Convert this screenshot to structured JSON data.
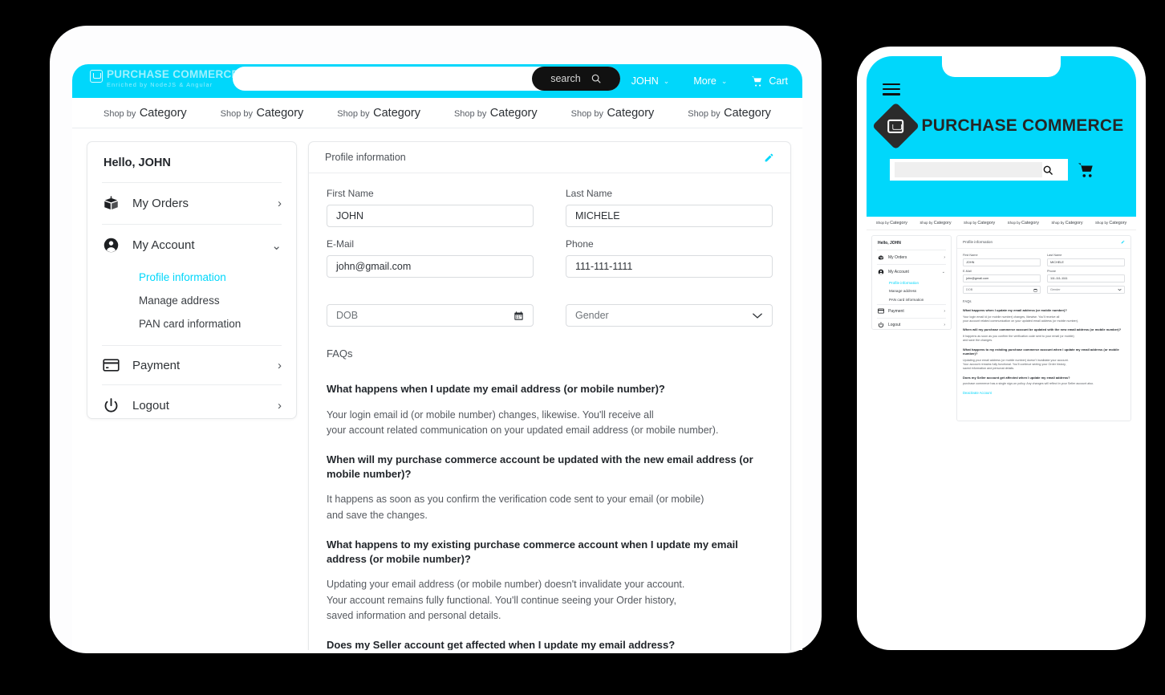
{
  "brand": {
    "name": "PURCHASE COMMERCE",
    "tagline": "Enriched by NodeJS & Angular",
    "accent": "#00d7fb",
    "dark": "#111111"
  },
  "desktop": {
    "header": {
      "search_placeholder": "",
      "search_value": "",
      "search_button": "search",
      "search_icon": "magnifier-icon",
      "user_menu": "JOHN",
      "more_menu": "More",
      "cart_label": "Cart",
      "cart_icon": "cart-icon",
      "chevron": "⌄"
    },
    "categories": [
      {
        "small": "Shop by",
        "big": "Category"
      },
      {
        "small": "Shop by",
        "big": "Category"
      },
      {
        "small": "Shop by",
        "big": "Category"
      },
      {
        "small": "Shop by",
        "big": "Category"
      },
      {
        "small": "Shop by",
        "big": "Category"
      },
      {
        "small": "Shop by",
        "big": "Category"
      }
    ],
    "sidebar": {
      "greeting": "Hello, JOHN",
      "items": [
        {
          "label": "My Orders",
          "icon": "box-icon",
          "arrow": "›"
        },
        {
          "label": "My Account",
          "icon": "person-icon",
          "arrow": "⌄"
        },
        {
          "label": "Payment",
          "icon": "credit-card-icon",
          "arrow": "›"
        },
        {
          "label": "Logout",
          "icon": "power-icon",
          "arrow": "›"
        }
      ],
      "account_submenu": [
        {
          "label": "Profile information",
          "active": true
        },
        {
          "label": "Manage address",
          "active": false
        },
        {
          "label": "PAN card information",
          "active": false
        }
      ]
    },
    "panel": {
      "title": "Profile information",
      "edit_icon": "pencil-icon",
      "fields": [
        {
          "label": "First Name",
          "value": "JOHN",
          "placeholder": "",
          "tail": ""
        },
        {
          "label": "Last Name",
          "value": "MICHELE",
          "placeholder": "",
          "tail": ""
        },
        {
          "label": "E-Mail",
          "value": "john@gmail.com",
          "placeholder": "",
          "tail": ""
        },
        {
          "label": "Phone",
          "value": "111-111-1111",
          "placeholder": "",
          "tail": ""
        },
        {
          "label": "",
          "value": "",
          "placeholder": "DOB",
          "tail": "calendar-icon"
        },
        {
          "label": "",
          "value": "",
          "placeholder": "Gender",
          "tail": "chevron-down-icon"
        }
      ],
      "faq_title": "FAQs",
      "faqs": [
        {
          "q": "What happens when I update my email address (or mobile number)?",
          "a": "Your login email id (or mobile number) changes, likewise. You'll receive all\nyour account related communication on your updated email address (or mobile number)."
        },
        {
          "q": "When will my purchase commerce account be updated with the new email address (or mobile number)?",
          "a": "It happens as soon as you confirm the verification code sent to your email (or mobile)\nand save the changes."
        },
        {
          "q": "What happens to my existing purchase commerce account when I update my email address\n(or mobile number)?",
          "a": "Updating your email address (or mobile number) doesn't invalidate your account.\nYour account remains fully functional. You'll continue seeing your Order history,\nsaved information and personal details."
        },
        {
          "q": "Does my Seller account get affected when I update my email address?",
          "a": ""
        }
      ]
    }
  },
  "mobile": {
    "menu_icon": "hamburger-icon",
    "logo_icon": "cart-diamond-icon",
    "logo_name": "PURCHASE COMMERCE",
    "search_placeholder": "",
    "search_icon": "magnifier-icon",
    "cart_icon": "cart-icon",
    "categories": [
      {
        "small": "Shop by",
        "big": "Category"
      },
      {
        "small": "Shop by",
        "big": "Category"
      },
      {
        "small": "Shop by",
        "big": "Category"
      },
      {
        "small": "Shop by",
        "big": "Category"
      },
      {
        "small": "Shop by",
        "big": "Category"
      },
      {
        "small": "Shop by",
        "big": "Category"
      }
    ],
    "sidebar": {
      "greeting": "Hello, JOHN",
      "items": [
        {
          "label": "My Orders",
          "icon": "box-icon",
          "arrow": "›"
        },
        {
          "label": "My Account",
          "icon": "person-icon",
          "arrow": "⌄"
        },
        {
          "label": "Payment",
          "icon": "credit-card-icon",
          "arrow": "›"
        },
        {
          "label": "Logout",
          "icon": "power-icon",
          "arrow": "›"
        }
      ],
      "account_submenu": [
        {
          "label": "Profile information",
          "active": true
        },
        {
          "label": "Manage address",
          "active": false
        },
        {
          "label": "PAN card information",
          "active": false
        }
      ]
    },
    "panel": {
      "title": "Profile information",
      "edit_icon": "pencil-icon",
      "fields": [
        {
          "label": "First Name",
          "value": "JOHN",
          "placeholder": "",
          "tail": ""
        },
        {
          "label": "Last Name",
          "value": "MICHELE",
          "placeholder": "",
          "tail": ""
        },
        {
          "label": "E-Mail",
          "value": "john@gmail.com",
          "placeholder": "",
          "tail": ""
        },
        {
          "label": "Phone",
          "value": "111-111-1111",
          "placeholder": "",
          "tail": ""
        },
        {
          "label": "",
          "value": "",
          "placeholder": "DOB",
          "tail": "calendar-icon"
        },
        {
          "label": "",
          "value": "",
          "placeholder": "Gender",
          "tail": "chevron-down-icon"
        }
      ],
      "faq_title": "FAQs",
      "faqs": [
        {
          "q": "What happens when I update my email address (or mobile number)?",
          "a": "Your login email id (or mobile number) changes, likewise. You'll receive all\nyour account related communication on your updated email address (or mobile number)."
        },
        {
          "q": "When will my purchase commerce account be updated with the new email address (or mobile number)?",
          "a": "It happens as soon as you confirm the verification code sent to your email (or mobile)\nand save the changes."
        },
        {
          "q": "What happens to my existing purchase commerce account when I update my email address\n(or mobile number)?",
          "a": "Updating your email address (or mobile number) doesn't invalidate your account.\nYour account remains fully functional. You'll continue seeing your Order history,\nsaved information and personal details."
        },
        {
          "q": "Does my Seller account get affected when I update my email address?",
          "a": "purchase commerce has a single sign-on policy. Any changes will reflect in your Seller account also."
        }
      ],
      "deactivate_label": "Deactivate Account"
    }
  }
}
